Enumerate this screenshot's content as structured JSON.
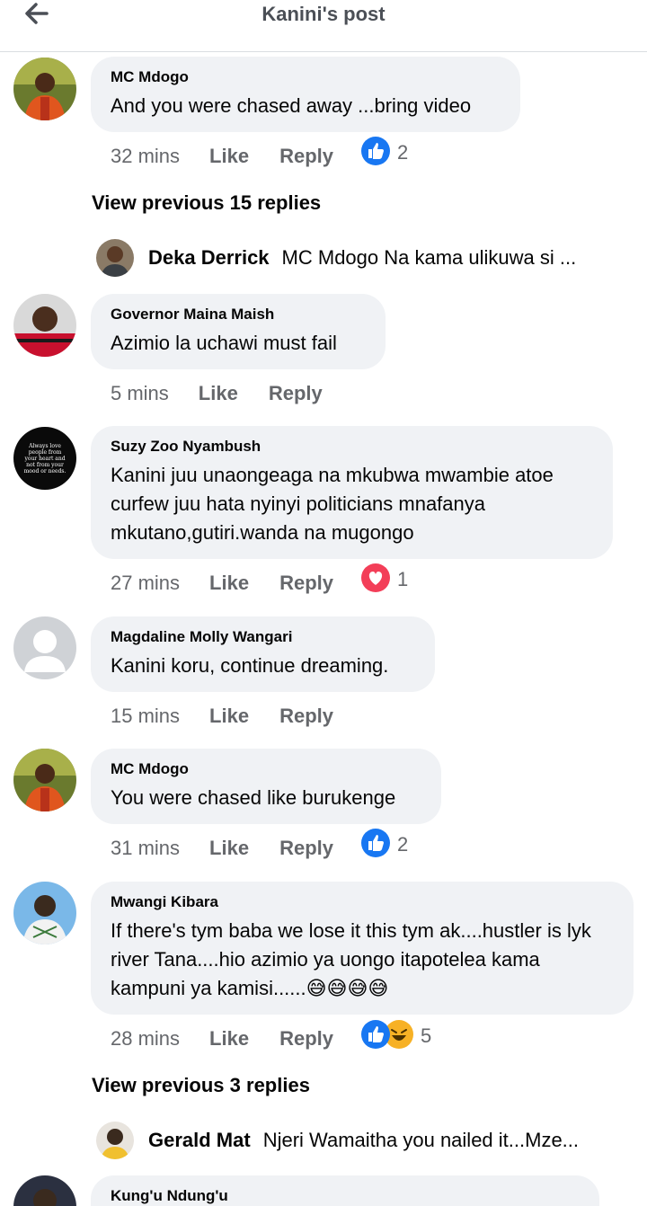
{
  "header": {
    "title": "Kanini's post"
  },
  "comments": [
    {
      "author": "MC Mdogo",
      "text": "And you were chased away ...bring video",
      "time": "32 mins",
      "like": "Like",
      "reply": "Reply",
      "reaction_count": "2",
      "reactions": [
        "like"
      ]
    },
    {
      "author": "Governor Maina Maish",
      "text": "Azimio la uchawi must fail",
      "time": "5 mins",
      "like": "Like",
      "reply": "Reply"
    },
    {
      "author": "Suzy Zoo Nyambush",
      "text": "Kanini juu unaongeaga na mkubwa mwambie atoe curfew juu hata nyinyi politicians mnafanya mkutano,gutiri.wanda na mugongo",
      "time": "27 mins",
      "like": "Like",
      "reply": "Reply",
      "reaction_count": "1",
      "reactions": [
        "love"
      ],
      "avatar_text": "Always love people from your heart and not from your mood or needs."
    },
    {
      "author": "Magdaline Molly Wangari",
      "text": "Kanini koru, continue dreaming.",
      "time": "15 mins",
      "like": "Like",
      "reply": "Reply"
    },
    {
      "author": "MC Mdogo",
      "text": "You were chased like burukenge",
      "time": "31 mins",
      "like": "Like",
      "reply": "Reply",
      "reaction_count": "2",
      "reactions": [
        "like"
      ]
    },
    {
      "author": "Mwangi Kibara",
      "text": "If there's tym baba we lose it this tym ak....hustler is lyk river Tana....hio azimio ya uongo itapotelea kama kampuni ya kamisi......😅😅😅😅",
      "time": "28 mins",
      "like": "Like",
      "reply": "Reply",
      "reaction_count": "5",
      "reactions": [
        "like",
        "haha"
      ]
    },
    {
      "author": "Kung'u Ndung'u"
    }
  ],
  "view_previous": [
    "View previous 15 replies",
    "View previous 3 replies"
  ],
  "reply_previews": [
    {
      "name": "Deka Derrick",
      "text": "MC Mdogo Na kama ulikuwa si ..."
    },
    {
      "name": "Gerald Mat",
      "text": "Njeri Wamaitha you nailed it...Mze..."
    }
  ],
  "colors": {
    "like_blue": "#1877f2",
    "love_red": "#f33e58",
    "haha_yellow": "#f7b125",
    "bubble_bg": "#f0f2f5",
    "meta_gray": "#65676b"
  }
}
